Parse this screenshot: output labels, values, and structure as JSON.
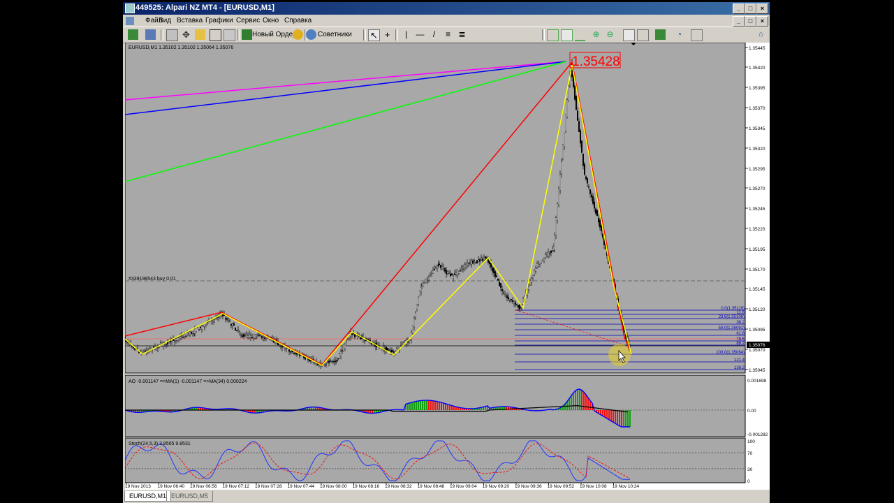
{
  "window": {
    "title": "449525: Alpari NZ MT4 - [EURUSD,M1]"
  },
  "menu": [
    "Файл",
    "Вид",
    "Вставка",
    "Графики",
    "Сервис",
    "Окно",
    "Справка"
  ],
  "toolbar": {
    "new_order": "Новый Ордер",
    "advisors": "Советники"
  },
  "chart": {
    "header": "EURUSD,M1  1.35102 1.35102 1.35064 1.35076",
    "order_line": "#339198543 buy 0.01",
    "peak_label": "1.35428",
    "current_price": "1.35076",
    "price_axis": [
      "1.35445",
      "1.35420",
      "1.35395",
      "1.35370",
      "1.35345",
      "1.35320",
      "1.35295",
      "1.35270",
      "1.35245",
      "1.35220",
      "1.35195",
      "1.35170",
      "1.35145",
      "1.35120",
      "1.35095",
      "1.35070",
      "1.35045"
    ],
    "fib_levels": [
      "0.0(1.35119)",
      "11.8",
      "23.6(1.35106)",
      "38.2",
      "50.0(1.35091)",
      "61.8",
      "78.6",
      "88.2",
      "100.0(1.35064)",
      "121.4",
      "138.2"
    ]
  },
  "ao": {
    "header": "AO -0.001147  =>MA(1) -0.001147  =>MA(34) 0.000224",
    "axis": [
      "0.001698",
      "0.00",
      "-0.001282"
    ]
  },
  "stoch": {
    "header": "Stoch(24,5,3) 3.8505 9.8531",
    "axis": [
      "100",
      "70",
      "30",
      "0"
    ]
  },
  "time_axis": [
    "19 Nov 2013",
    "19 Nov 06:40",
    "19 Nov 06:56",
    "19 Nov 07:12",
    "19 Nov 07:28",
    "19 Nov 07:44",
    "19 Nov 08:00",
    "19 Nov 08:16",
    "19 Nov 08:32",
    "19 Nov 08:48",
    "19 Nov 09:04",
    "19 Nov 09:20",
    "19 Nov 09:36",
    "19 Nov 09:52",
    "19 Nov 10:08",
    "19 Nov 10:24"
  ],
  "tabs": [
    "EURUSD,M1",
    "EURUSD,M5"
  ],
  "colors": {
    "chart_bg": "#a8a8a8",
    "zigzag_red": "#ff0000",
    "zigzag_yellow": "#ffff00",
    "fib_blue": "#0000c0",
    "magenta": "#ff00ff",
    "green": "#00ff00",
    "ao_up": "#00a000",
    "ao_down": "#ff0000",
    "ao_line": "#0000ff",
    "stoch_main": "#2233ff",
    "stoch_signal": "#ff0000"
  }
}
